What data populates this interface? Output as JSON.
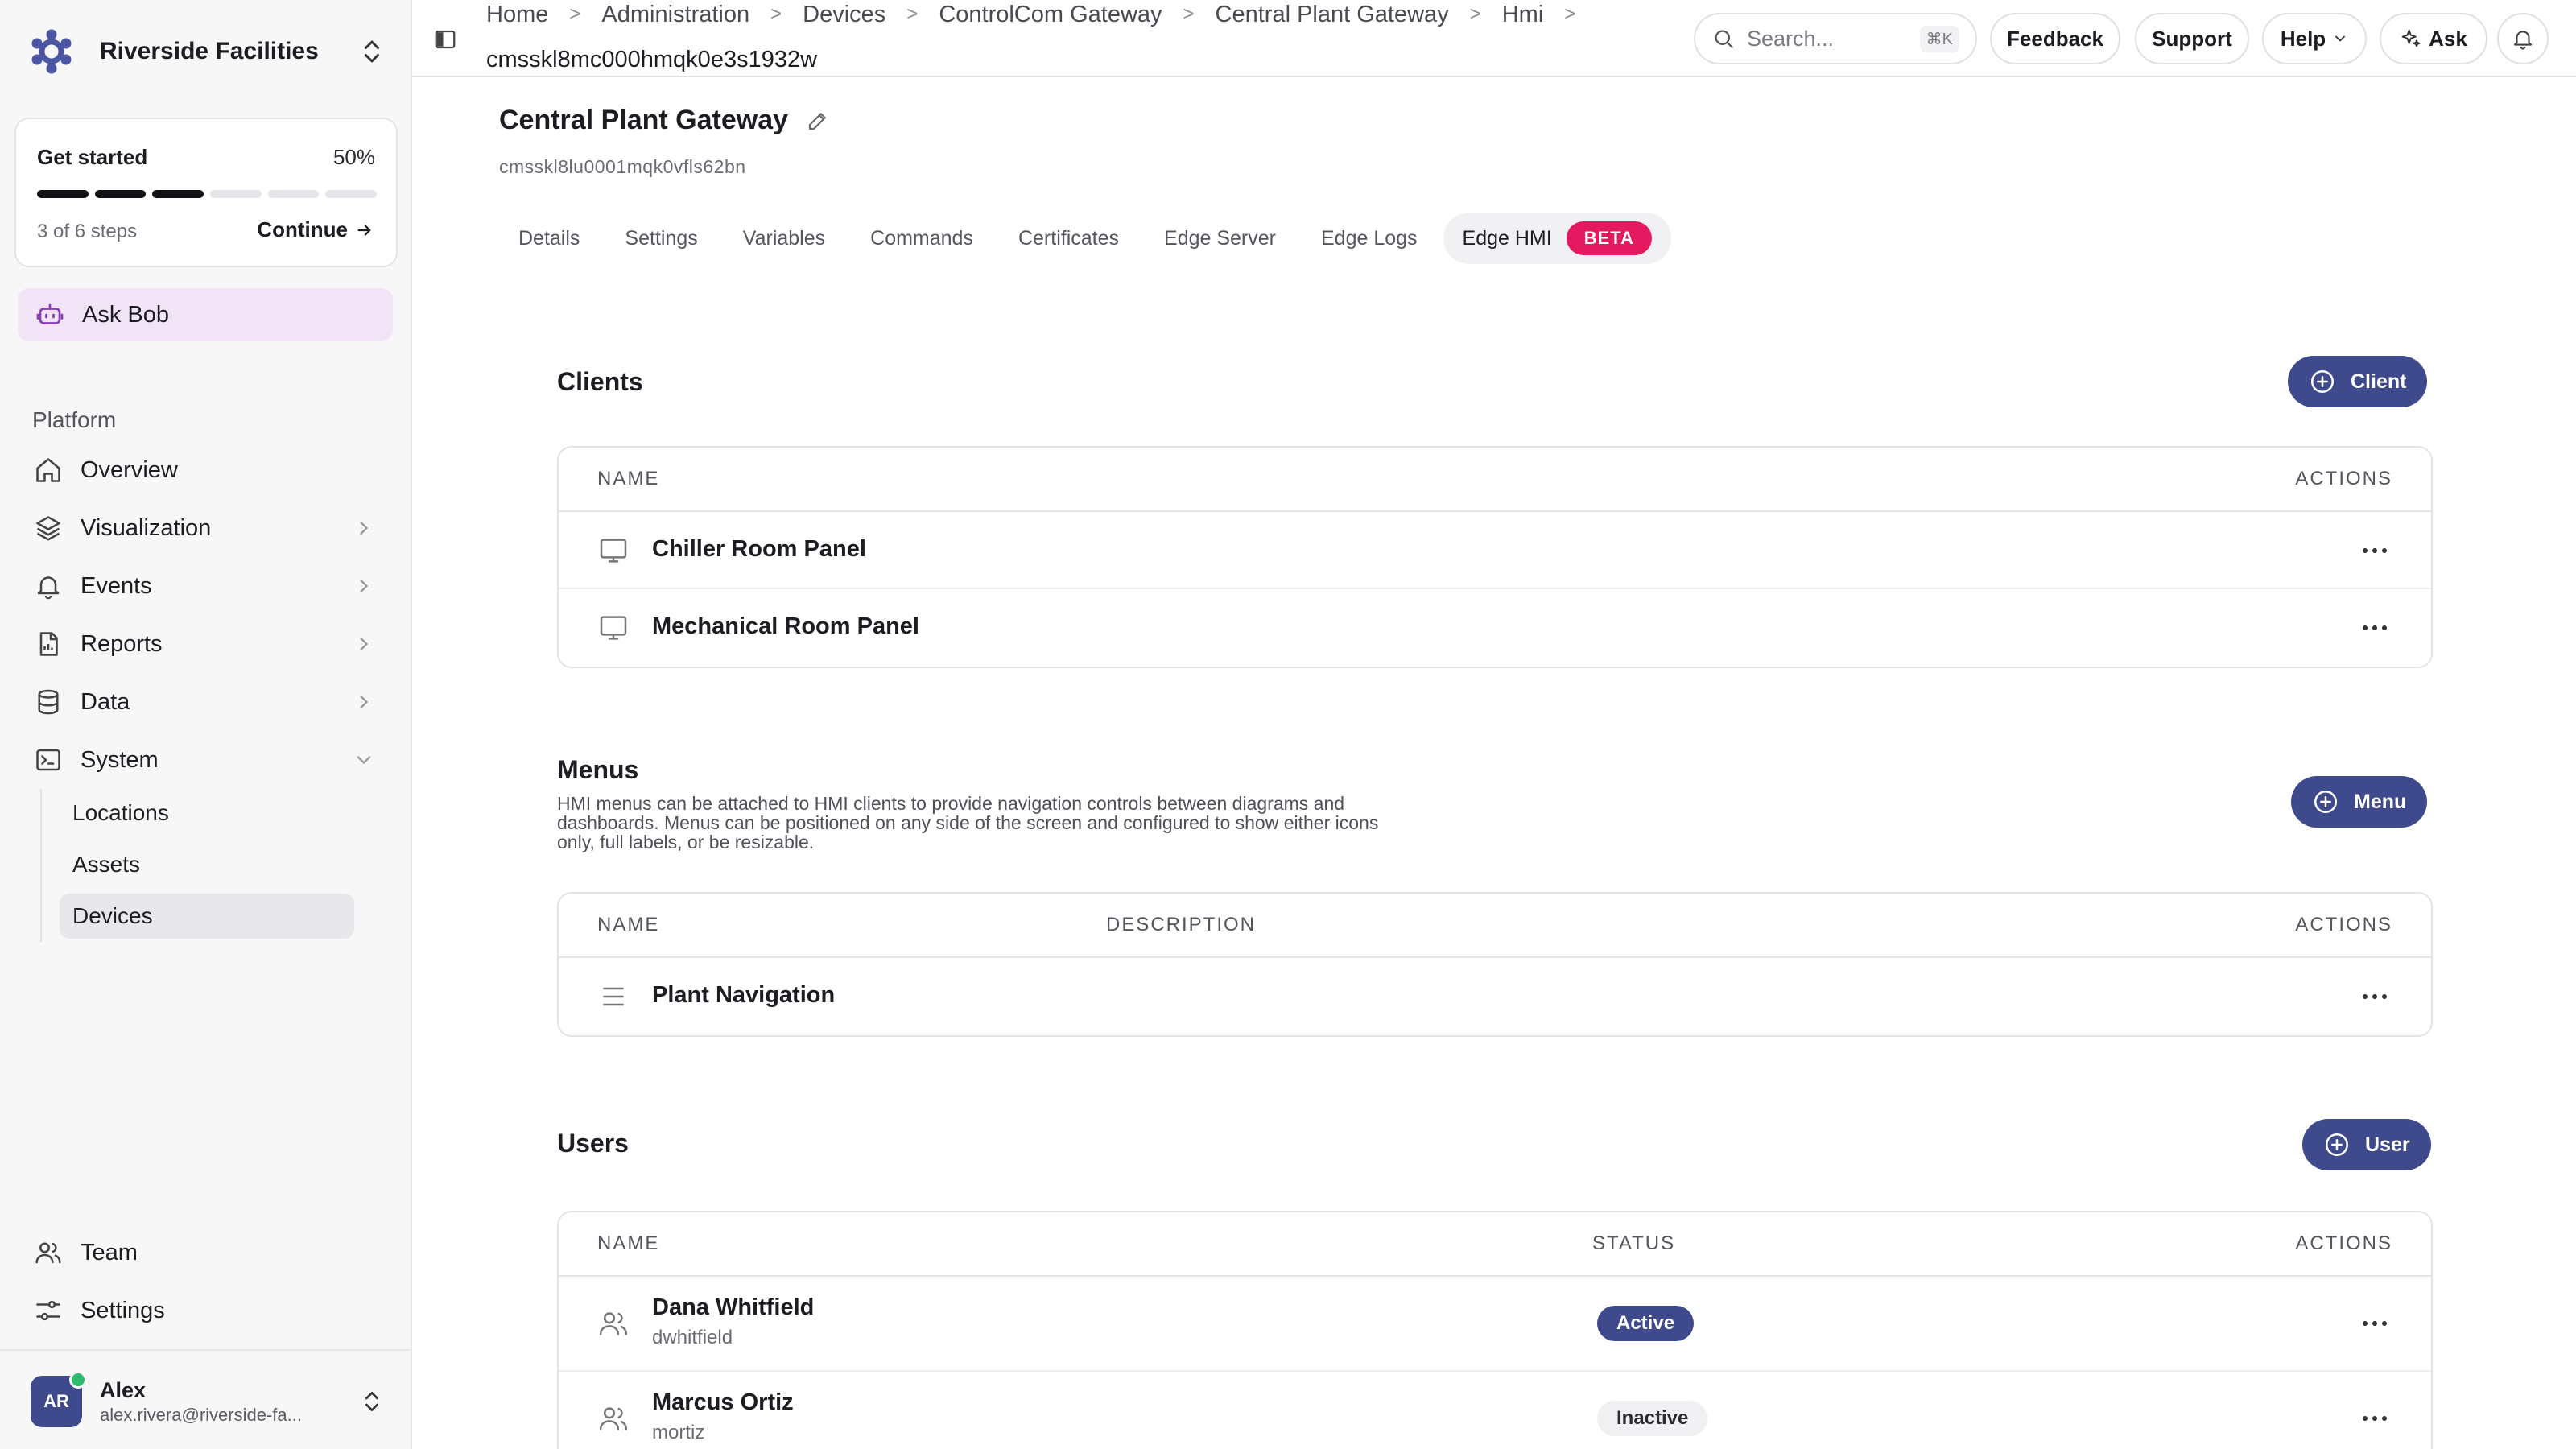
{
  "sidebar": {
    "org_name": "Riverside Facilities",
    "get_started": {
      "title": "Get started",
      "percent": "50%",
      "progress": 0.5,
      "steps": "3 of 6 steps",
      "continue": "Continue"
    },
    "ask_bob": "Ask Bob",
    "section": "Platform",
    "nav": [
      {
        "label": "Overview",
        "icon": "home-icon"
      },
      {
        "label": "Visualization",
        "icon": "layers-icon"
      },
      {
        "label": "Events",
        "icon": "bell-icon"
      },
      {
        "label": "Reports",
        "icon": "report-icon"
      },
      {
        "label": "Data",
        "icon": "database-icon"
      },
      {
        "label": "System",
        "icon": "terminal-icon"
      }
    ],
    "system_sub": [
      "Locations",
      "Assets",
      "Devices"
    ],
    "bottom_nav": [
      {
        "label": "Team",
        "icon": "team-icon"
      },
      {
        "label": "Settings",
        "icon": "sliders-icon"
      }
    ],
    "user": {
      "initials": "AR",
      "name": "Alex",
      "email": "alex.rivera@riverside-fa..."
    }
  },
  "topbar": {
    "breadcrumbs": [
      "Home",
      "Administration",
      "Devices",
      "ControlCom Gateway",
      "Central Plant Gateway",
      "Hmi"
    ],
    "breadcrumb_last": "cmsskl8mc000hmqk0e3s1932w",
    "search_placeholder": "Search...",
    "search_shortcut": "⌘K",
    "buttons": {
      "feedback": "Feedback",
      "support": "Support",
      "help": "Help",
      "ask": "Ask"
    }
  },
  "page": {
    "title": "Central Plant Gateway",
    "id": "cmsskl8lu0001mqk0vfls62bn",
    "tabs": [
      "Details",
      "Settings",
      "Variables",
      "Commands",
      "Certificates",
      "Edge Server",
      "Edge Logs",
      "Edge HMI"
    ],
    "beta": "BETA"
  },
  "clients": {
    "title": "Clients",
    "add": "Client",
    "columns": {
      "name": "NAME",
      "actions": "ACTIONS"
    },
    "rows": [
      "Chiller Room Panel",
      "Mechanical Room Panel"
    ]
  },
  "menus": {
    "title": "Menus",
    "description": "HMI menus can be attached to HMI clients to provide navigation controls between diagrams and dashboards. Menus can be positioned on any side of the screen and configured to show either icons only, full labels, or be resizable.",
    "add": "Menu",
    "columns": {
      "name": "NAME",
      "description": "DESCRIPTION",
      "actions": "ACTIONS"
    },
    "rows": [
      "Plant Navigation"
    ]
  },
  "users": {
    "title": "Users",
    "add": "User",
    "columns": {
      "name": "NAME",
      "status": "STATUS",
      "actions": "ACTIONS"
    },
    "rows": [
      {
        "name": "Dana Whitfield",
        "username": "dwhitfield",
        "status": "Active"
      },
      {
        "name": "Marcus Ortiz",
        "username": "mortiz",
        "status": "Inactive"
      }
    ]
  },
  "colors": {
    "primary": "#3e4a8c",
    "beta": "#e5195f",
    "ask_bob_bg": "#f1e4f7",
    "online": "#2dbb6f"
  }
}
